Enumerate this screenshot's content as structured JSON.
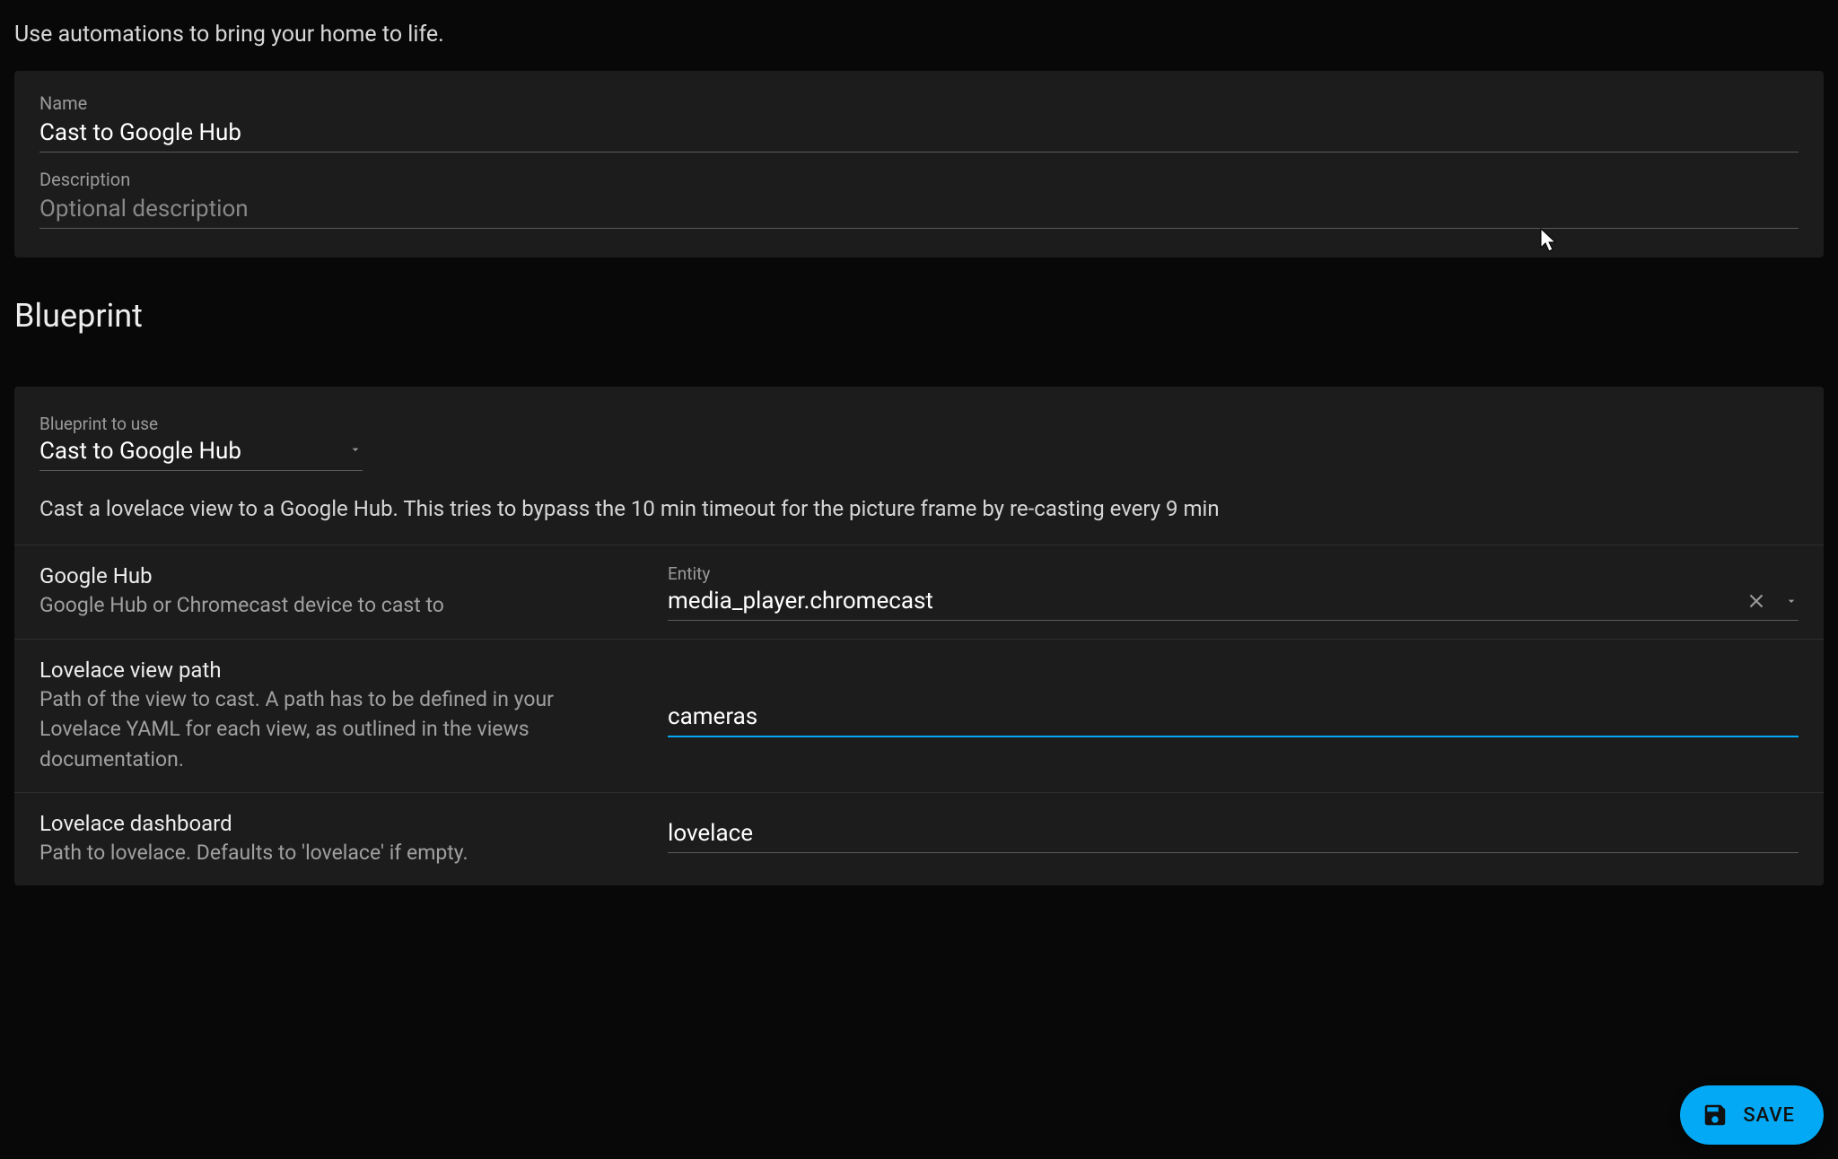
{
  "intro": "Use automations to bring your home to life.",
  "fields": {
    "name": {
      "label": "Name",
      "value": "Cast to Google Hub"
    },
    "description": {
      "label": "Description",
      "placeholder": "Optional description",
      "value": ""
    }
  },
  "blueprint": {
    "heading": "Blueprint",
    "select": {
      "label": "Blueprint to use",
      "value": "Cast to Google Hub"
    },
    "description": "Cast a lovelace view to a Google Hub. This tries to bypass the 10 min timeout for the picture frame by re-casting every 9 min",
    "rows": {
      "google_hub": {
        "title": "Google Hub",
        "help": "Google Hub or Chromecast device to cast to",
        "entity_label": "Entity",
        "entity_value": "media_player.chromecast"
      },
      "view_path": {
        "title": "Lovelace view path",
        "help": "Path of the view to cast. A path has to be defined in your Lovelace YAML for each view, as outlined in the views documentation.",
        "value": "cameras"
      },
      "dashboard": {
        "title": "Lovelace dashboard",
        "help": "Path to lovelace. Defaults to 'lovelace' if empty.",
        "value": "lovelace"
      }
    }
  },
  "fab": {
    "label": "SAVE"
  }
}
